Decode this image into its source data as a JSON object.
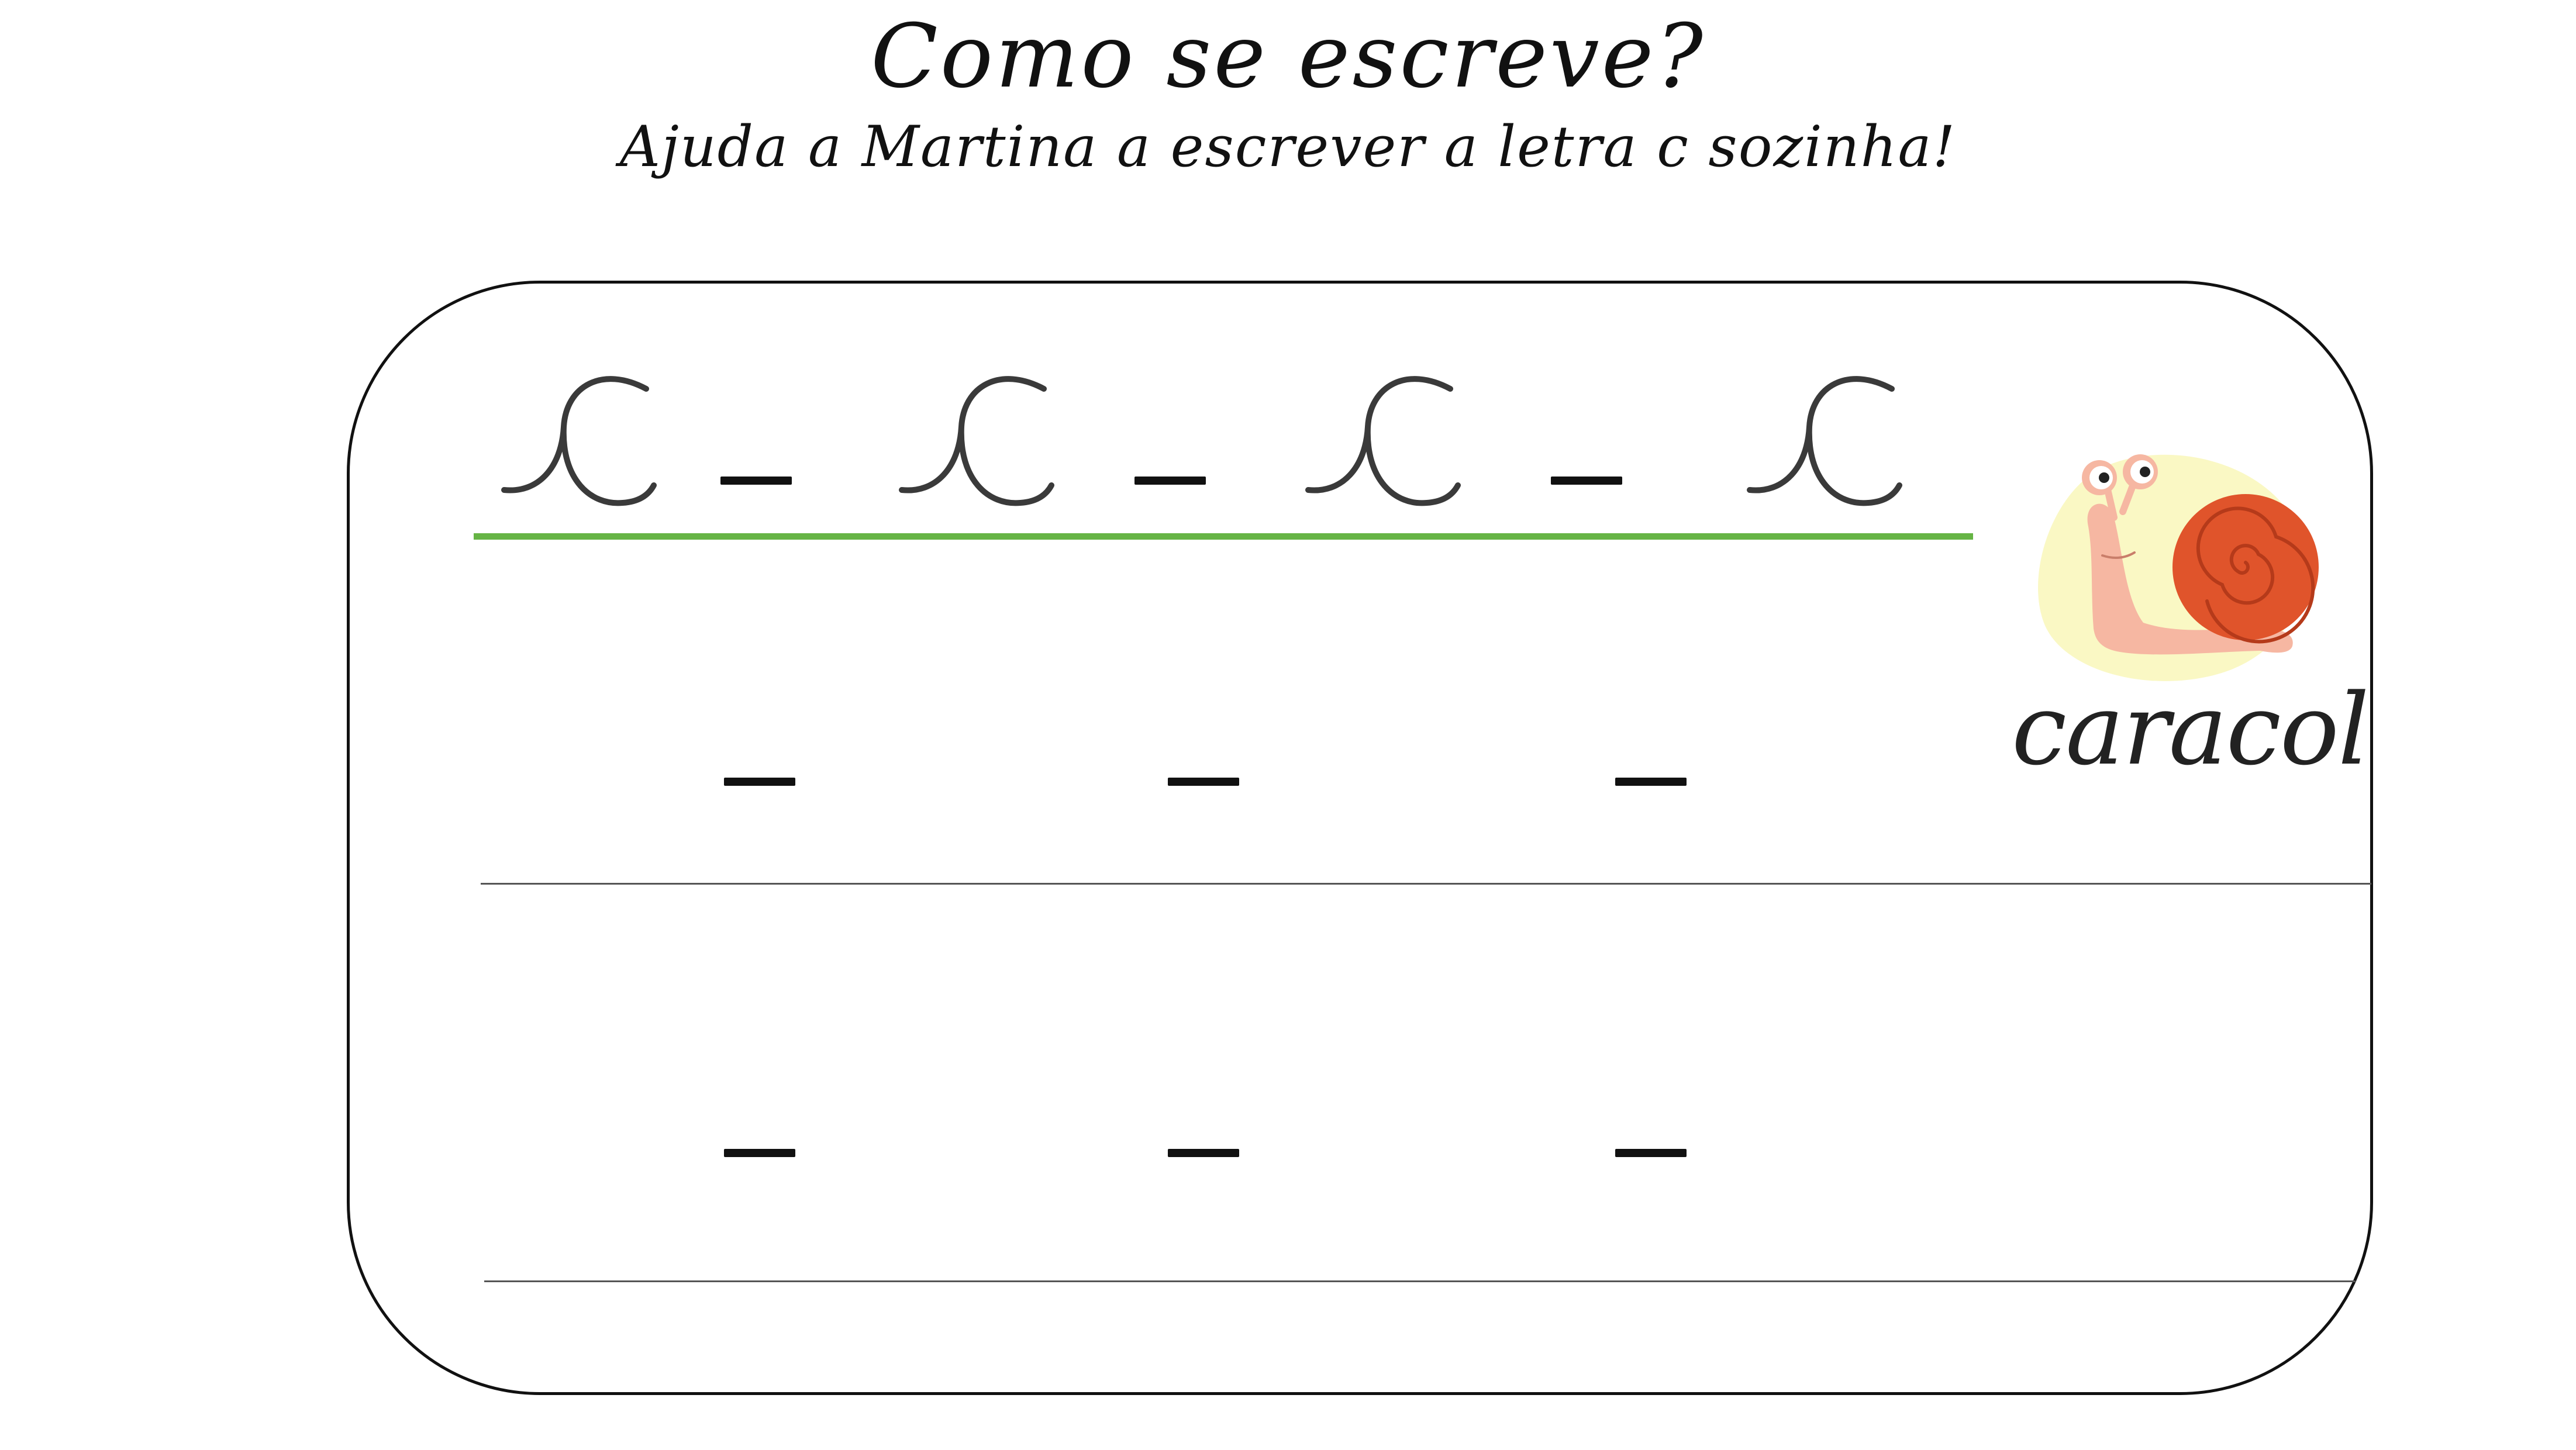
{
  "header": {
    "title": "Como se escreve?",
    "subtitle": "Ajuda a Martina a escrever a letra c sozinha!"
  },
  "example": {
    "letter": "c",
    "word": "caracol"
  },
  "colors": {
    "guide_line": "#66b445",
    "glyph_stroke": "#3a3a3a",
    "snail_shell": "#e0542b",
    "snail_body": "#f6b7a2",
    "snail_halo": "#faf8c4"
  },
  "icons": {
    "illustration": "snail-icon"
  }
}
